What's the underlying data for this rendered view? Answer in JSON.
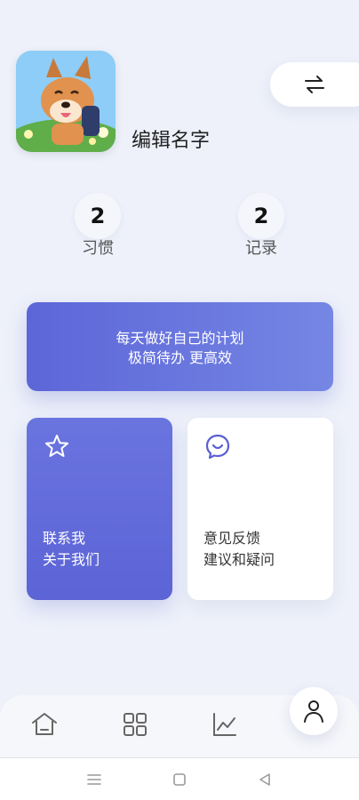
{
  "profile": {
    "avatar_icon": "dog-avatar-image",
    "name": "编辑名字",
    "switch_icon": "swap-arrows-icon"
  },
  "stats": [
    {
      "value": "2",
      "label": "习惯"
    },
    {
      "value": "2",
      "label": "记录"
    }
  ],
  "banner": {
    "line1": "每天做好自己的计划",
    "line2": "极简待办 更高效"
  },
  "cards": {
    "contact": {
      "icon": "star-icon",
      "line1": "联系我",
      "line2": "关于我们"
    },
    "feedback": {
      "icon": "chat-smile-icon",
      "line1": "意见反馈",
      "line2": "建议和疑问"
    }
  },
  "bottom_nav": {
    "items": [
      "home-icon",
      "grid-icon",
      "chart-icon",
      "profile-icon"
    ],
    "active": "profile-icon"
  },
  "system_nav": [
    "menu-icon",
    "home-square-icon",
    "back-triangle-icon"
  ],
  "colors": {
    "background": "#eef1fa",
    "accent_start": "#5d66d8",
    "accent_end": "#7586e4",
    "feedback_icon": "#5a5fd4"
  }
}
